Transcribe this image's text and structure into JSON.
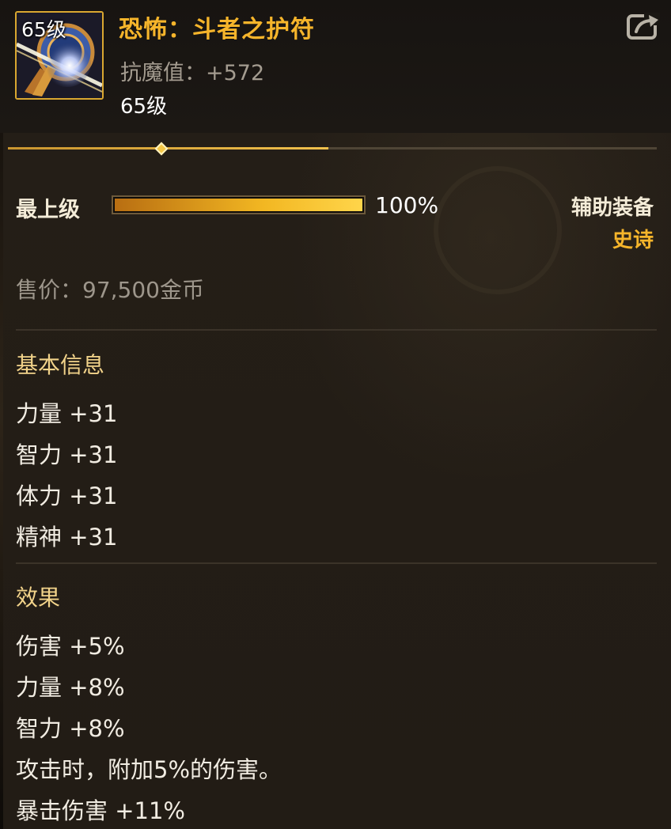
{
  "item": {
    "name": "恐怖：斗者之护符",
    "icon_level": "65级",
    "stat_line": "抗魔值：+572",
    "level": "65级",
    "icon": "amulet-icon"
  },
  "header": {
    "share_icon": "share-icon"
  },
  "grade": {
    "label": "最上级",
    "percent_text": "100%",
    "percent": 100
  },
  "equip": {
    "type": "辅助装备",
    "rarity": "史诗"
  },
  "price": "售价：97,500金币",
  "basic_info": {
    "title": "基本信息",
    "stats": [
      "力量 +31",
      "智力 +31",
      "体力 +31",
      "精神 +31"
    ]
  },
  "effects": {
    "title": "效果",
    "lines": [
      "伤害 +5%",
      "力量 +8%",
      "智力 +8%",
      "攻击时，附加5%的伤害。",
      "暴击伤害 +11%"
    ]
  },
  "colors": {
    "accent": "#f6b52b",
    "section": "#f2d38a",
    "background": "#221c15"
  }
}
